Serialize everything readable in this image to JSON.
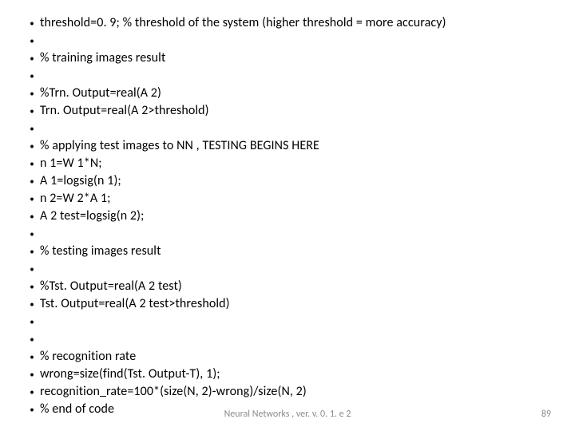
{
  "lines": [
    "threshold=0. 9; % threshold of the system (higher threshold = more accuracy)",
    "",
    "% training images result",
    "",
    "%Trn. Output=real(A 2)",
    "Trn. Output=real(A 2>threshold)",
    "",
    "% applying test images to NN , TESTING BEGINS HERE",
    "n 1=W 1*N;",
    "A 1=logsig(n 1);",
    "n 2=W 2*A 1;",
    "A 2 test=logsig(n 2);",
    "",
    "% testing images result",
    "",
    "%Tst. Output=real(A 2 test)",
    "Tst. Output=real(A 2 test>threshold)",
    "",
    "",
    "% recognition rate",
    "wrong=size(find(Tst. Output-T), 1);",
    "recognition_rate=100*(size(N, 2)-wrong)/size(N, 2)",
    "% end of code"
  ],
  "footer": {
    "center": "Neural Networks  , ver. v. 0. 1. e 2",
    "page": "89"
  }
}
